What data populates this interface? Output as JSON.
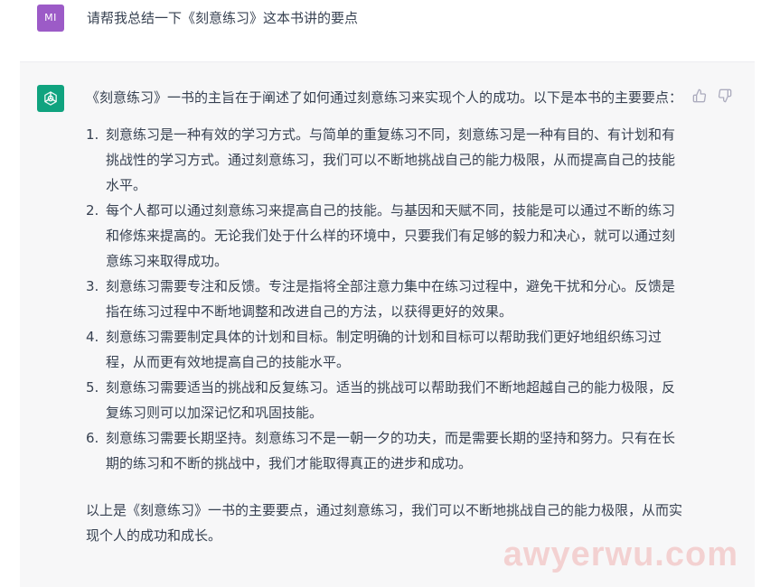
{
  "user": {
    "initials": "MI",
    "avatar_color": "#9c5bc7",
    "message": "请帮我总结一下《刻意练习》这本书讲的要点"
  },
  "assistant": {
    "logo": "openai-logo-icon",
    "logo_color": "#10a37f",
    "intro": "《刻意练习》一书的主旨在于阐述了如何通过刻意练习来实现个人的成功。以下是本书的主要要点：",
    "points": [
      {
        "num": "1.",
        "text": "刻意练习是一种有效的学习方式。与简单的重复练习不同，刻意练习是一种有目的、有计划和有挑战性的学习方式。通过刻意练习，我们可以不断地挑战自己的能力极限，从而提高自己的技能水平。"
      },
      {
        "num": "2.",
        "text": "每个人都可以通过刻意练习来提高自己的技能。与基因和天赋不同，技能是可以通过不断的练习和修炼来提高的。无论我们处于什么样的环境中，只要我们有足够的毅力和决心，就可以通过刻意练习来取得成功。"
      },
      {
        "num": "3.",
        "text": "刻意练习需要专注和反馈。专注是指将全部注意力集中在练习过程中，避免干扰和分心。反馈是指在练习过程中不断地调整和改进自己的方法，以获得更好的效果。"
      },
      {
        "num": "4.",
        "text": "刻意练习需要制定具体的计划和目标。制定明确的计划和目标可以帮助我们更好地组织练习过程，从而更有效地提高自己的技能水平。"
      },
      {
        "num": "5.",
        "text": "刻意练习需要适当的挑战和反复练习。适当的挑战可以帮助我们不断地超越自己的能力极限，反复练习则可以加深记忆和巩固技能。"
      },
      {
        "num": "6.",
        "text": "刻意练习需要长期坚持。刻意练习不是一朝一夕的功夫，而是需要长期的坚持和努力。只有在长期的练习和不断的挑战中，我们才能取得真正的进步和成功。"
      }
    ],
    "outro": "以上是《刻意练习》一书的主要要点，通过刻意练习，我们可以不断地挑战自己的能力极限，从而实现个人的成功和成长。",
    "actions": [
      "thumbs-up-icon",
      "thumbs-down-icon"
    ]
  },
  "watermark": "awyerwu.com"
}
